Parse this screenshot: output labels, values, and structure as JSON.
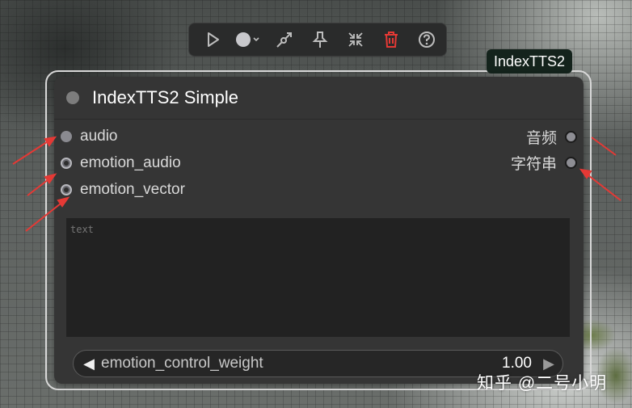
{
  "toolbar": {
    "buttons": [
      {
        "icon": "play-icon"
      },
      {
        "icon": "color-dot-icon"
      },
      {
        "icon": "bypass-icon"
      },
      {
        "icon": "pin-icon"
      },
      {
        "icon": "collapse-icon"
      },
      {
        "icon": "trash-icon"
      },
      {
        "icon": "help-icon"
      }
    ]
  },
  "group": {
    "badge": "IndexTTS2"
  },
  "node": {
    "title": "IndexTTS2 Simple",
    "inputs": [
      {
        "label": "audio"
      },
      {
        "label": "emotion_audio"
      },
      {
        "label": "emotion_vector"
      }
    ],
    "outputs": [
      {
        "label": "音频"
      },
      {
        "label": "字符串"
      }
    ],
    "text_placeholder": "text",
    "widget": {
      "label": "emotion_control_weight",
      "value": "1.00",
      "decrement": "◀",
      "increment": "▶"
    }
  },
  "watermark": "知乎 @二号小明",
  "colors": {
    "accent_red": "#e53935",
    "badge_bg": "#14231c",
    "node_bg": "#353535"
  }
}
